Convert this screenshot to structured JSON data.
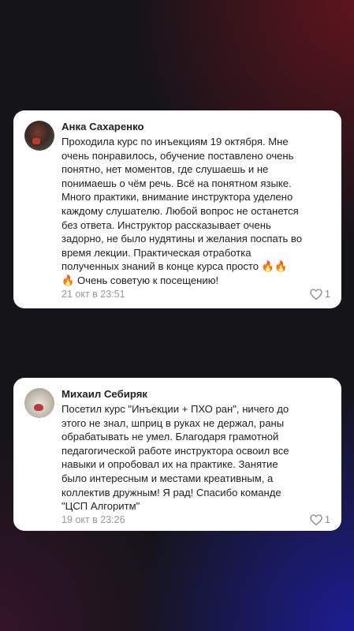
{
  "reviews": [
    {
      "author": "Анка Сахаренко",
      "text": "Проходила курс по инъекциям 19 октября. Мне\nочень понравилось, обучение поставлено очень\nпонятно, нет моментов, где слушаешь и не\nпонимаешь о чём речь. Всё на понятном языке.\nМного практики, внимание инструктора уделено\nкаждому слушателю. Любой вопрос не останется\nбез ответа. Инструктор рассказывает очень\nзадорно, не было нудятины и желания поспать во\nвремя лекции. Практическая отработка\nполученных знаний в конце курса просто 🔥🔥\n🔥 Очень советую к посещению!",
      "date": "21 окт в 23:51",
      "likes": "1"
    },
    {
      "author": "Михаил Себиряк",
      "text": "Посетил курс \"Инъекции + ПХО ран\", ничего до\nэтого не знал, шприц в руках не держал, раны\nобрабатывать не умел. Благодаря грамотной\nпедагогической работе инструктора освоил все\nнавыки и опробовал их на практике. Занятие\nбыло интересным и местами креативным, а\nколлектив дружным! Я рад! Спасибо команде\n\"ЦСП Алгоритм\"",
      "date": "19 окт в 23:26",
      "likes": "1"
    }
  ]
}
